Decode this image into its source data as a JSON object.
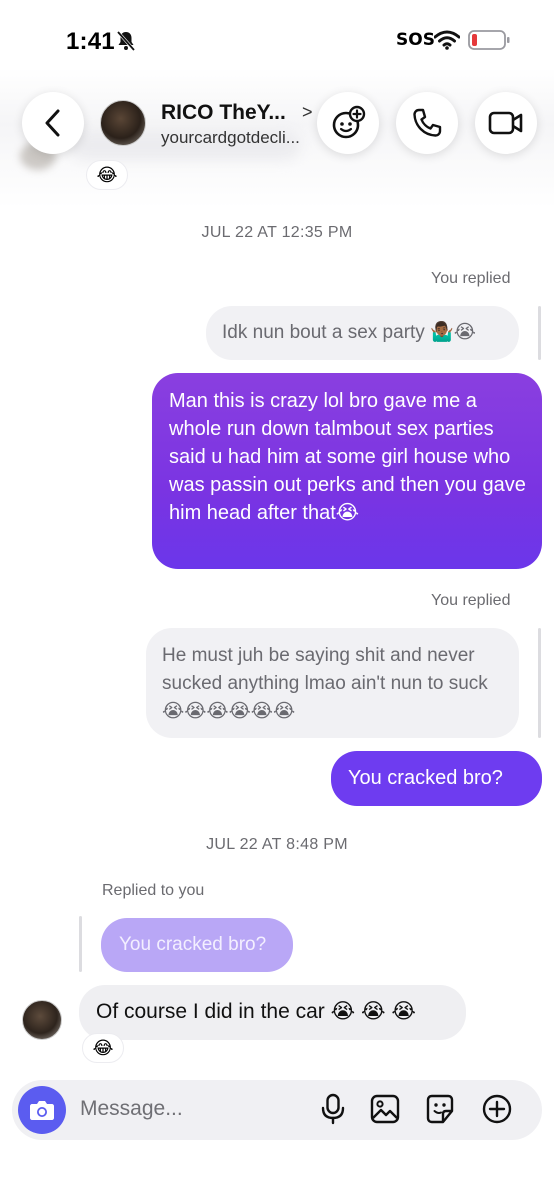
{
  "status_bar": {
    "time": "1:41",
    "sos": "SOS"
  },
  "header": {
    "name": "RICO TheY...",
    "handle": "yourcardgotdecli...",
    "chevron": ">"
  },
  "partial_reaction": "😂",
  "thread": {
    "timestamp_1": "JUL 22 AT 12:35 PM",
    "you_replied_1": "You replied",
    "quoted_1": "Idk nun bout a sex party 🤷🏾‍♂️😭",
    "message_1": "Man this is crazy lol bro gave me a whole run down talmbout sex parties said u had him at some girl house who was passin out perks and then you gave him head after that😭",
    "you_replied_2": "You replied",
    "quoted_2": "He must juh be saying shit and never sucked anything lmao ain't nun to suck 😭😭😭😭😭😭",
    "message_2": "You cracked bro?",
    "timestamp_2": "JUL 22 AT 8:48 PM",
    "replied_to_you": "Replied to you",
    "quoted_3": "You cracked bro?",
    "incoming_message": "Of course I did in the car 😭 😭 😭",
    "incoming_reaction": "😂"
  },
  "composer": {
    "placeholder": "Message..."
  },
  "colors": {
    "accent_purple": "#7a34e2",
    "camera_blue": "#5b5cf0",
    "battery_red": "#e5393b"
  }
}
